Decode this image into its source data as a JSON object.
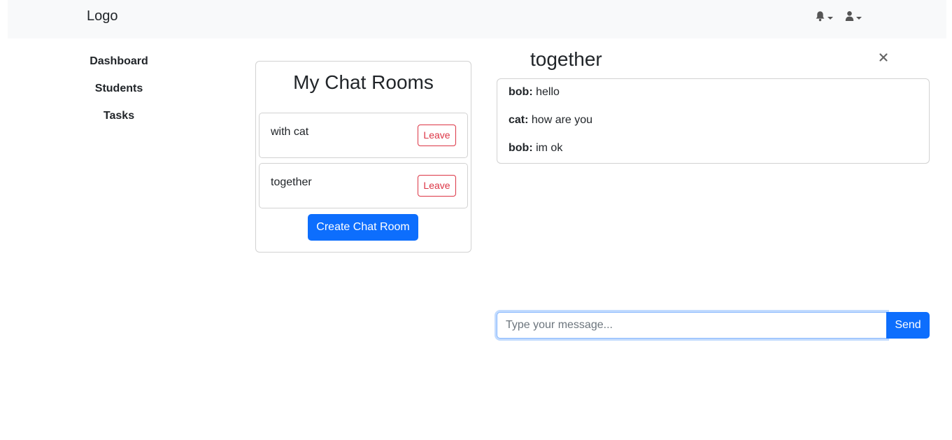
{
  "navbar": {
    "logo": "Logo",
    "icons": [
      "bell-icon",
      "user-icon"
    ]
  },
  "sidebar": {
    "items": [
      {
        "label": "Dashboard"
      },
      {
        "label": "Students"
      },
      {
        "label": "Tasks"
      }
    ]
  },
  "rooms": {
    "title": "My Chat Rooms",
    "items": [
      {
        "name": "with cat",
        "leave_label": "Leave"
      },
      {
        "name": "together",
        "leave_label": "Leave"
      }
    ],
    "create_label": "Create Chat Room"
  },
  "chat": {
    "title": "together",
    "close_icon": "close-icon",
    "messages": [
      {
        "sender": "bob:",
        "text": " hello"
      },
      {
        "sender": "cat:",
        "text": " how are you"
      },
      {
        "sender": "bob:",
        "text": " im ok"
      }
    ],
    "input_placeholder": "Type your message...",
    "send_label": "Send"
  },
  "colors": {
    "primary": "#0d6efd",
    "danger": "#dc3545",
    "navbar_bg": "#f8f9fa"
  }
}
